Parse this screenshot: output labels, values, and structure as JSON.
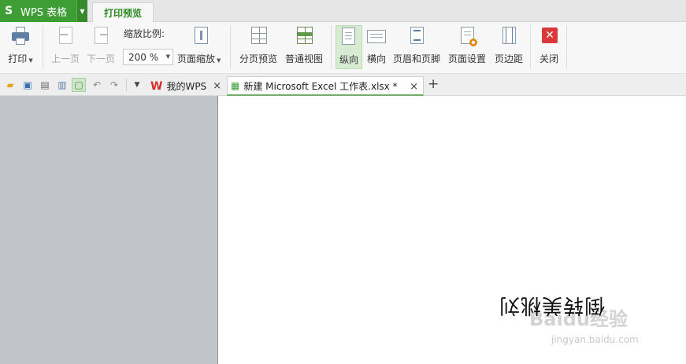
{
  "titlebar": {
    "app_logo": "S",
    "app_name": "WPS 表格",
    "active_tab": "打印预览"
  },
  "ribbon": {
    "print": "打印",
    "prev_page": "上一页",
    "next_page": "下一页",
    "zoom_label": "缩放比例:",
    "zoom_value": "200 %",
    "page_zoom": "页面缩放",
    "page_break_preview": "分页预览",
    "normal_view": "普通视图",
    "portrait": "纵向",
    "landscape": "横向",
    "header_footer": "页眉和页脚",
    "page_setup": "页面设置",
    "margins": "页边距",
    "close": "关闭"
  },
  "tabs": {
    "my_wps": "我的WPS",
    "document": "新建 Microsoft Excel 工作表.xlsx *",
    "close_glyph": "×",
    "new_tab_glyph": "+"
  },
  "content": {
    "mirrored_text": "倒转美桃刘",
    "watermark": "Baidu经验",
    "watermark_url": "jingyan.baidu.com"
  },
  "icons": {
    "open": "folder-open-icon",
    "save": "save-icon",
    "pdf": "export-pdf-icon",
    "print": "print-icon",
    "preview": "print-preview-icon",
    "undo": "undo-icon",
    "redo": "redo-icon"
  },
  "colors": {
    "brand_green": "#3f9d35",
    "active_tab_text": "#2d8a23",
    "close_red": "#d9393b"
  }
}
